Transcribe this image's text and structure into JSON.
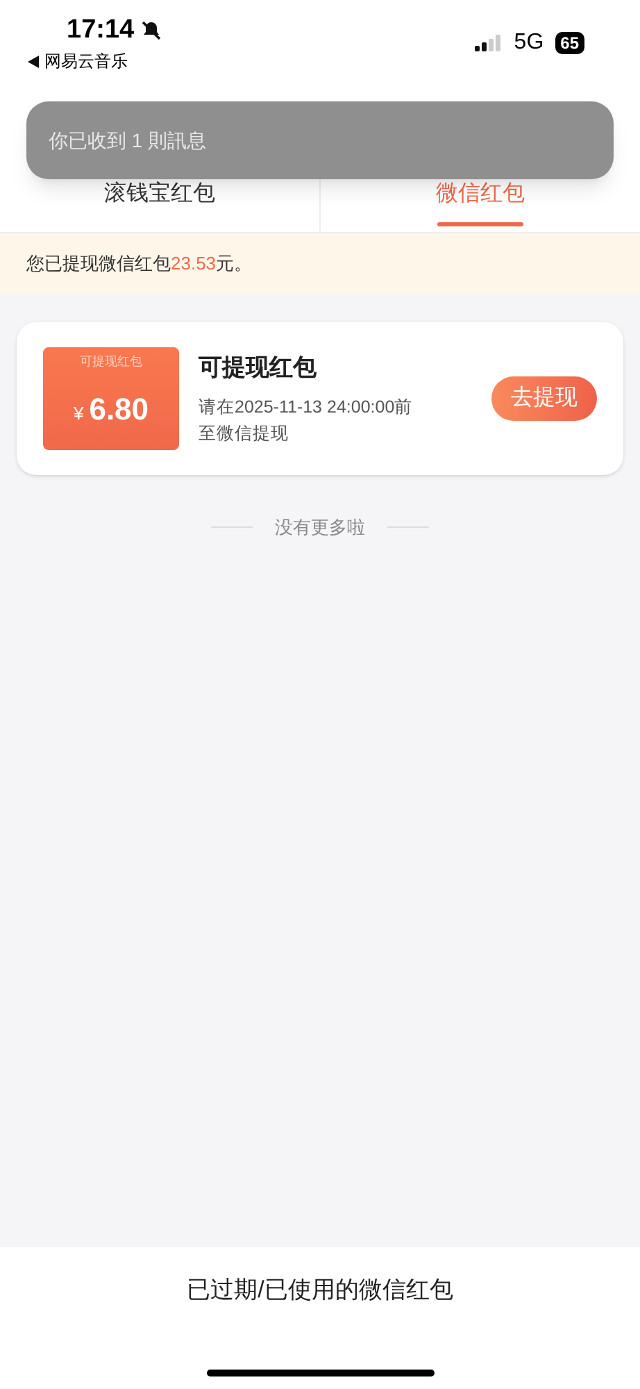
{
  "status_bar": {
    "time": "17:14",
    "back_app": "网易云音乐",
    "network": "5G",
    "battery": "65"
  },
  "notification": {
    "text": "你已收到 1 則訊息"
  },
  "tabs": [
    {
      "label": "滚钱宝红包",
      "selected": false
    },
    {
      "label": "微信红包",
      "selected": true
    }
  ],
  "notice": "您已提现微信红包**23.53**元。",
  "cards": [
    {
      "badge": "可提现红包",
      "currency": "¥",
      "amount": "6.80",
      "title": "可提现红包",
      "deadline": "请在2025-11-13 24:00:00前",
      "note": "至微信提现",
      "button": "去提现"
    }
  ],
  "end_text": "没有更多啦",
  "footer_link": "已过期/已使用的微信红包"
}
